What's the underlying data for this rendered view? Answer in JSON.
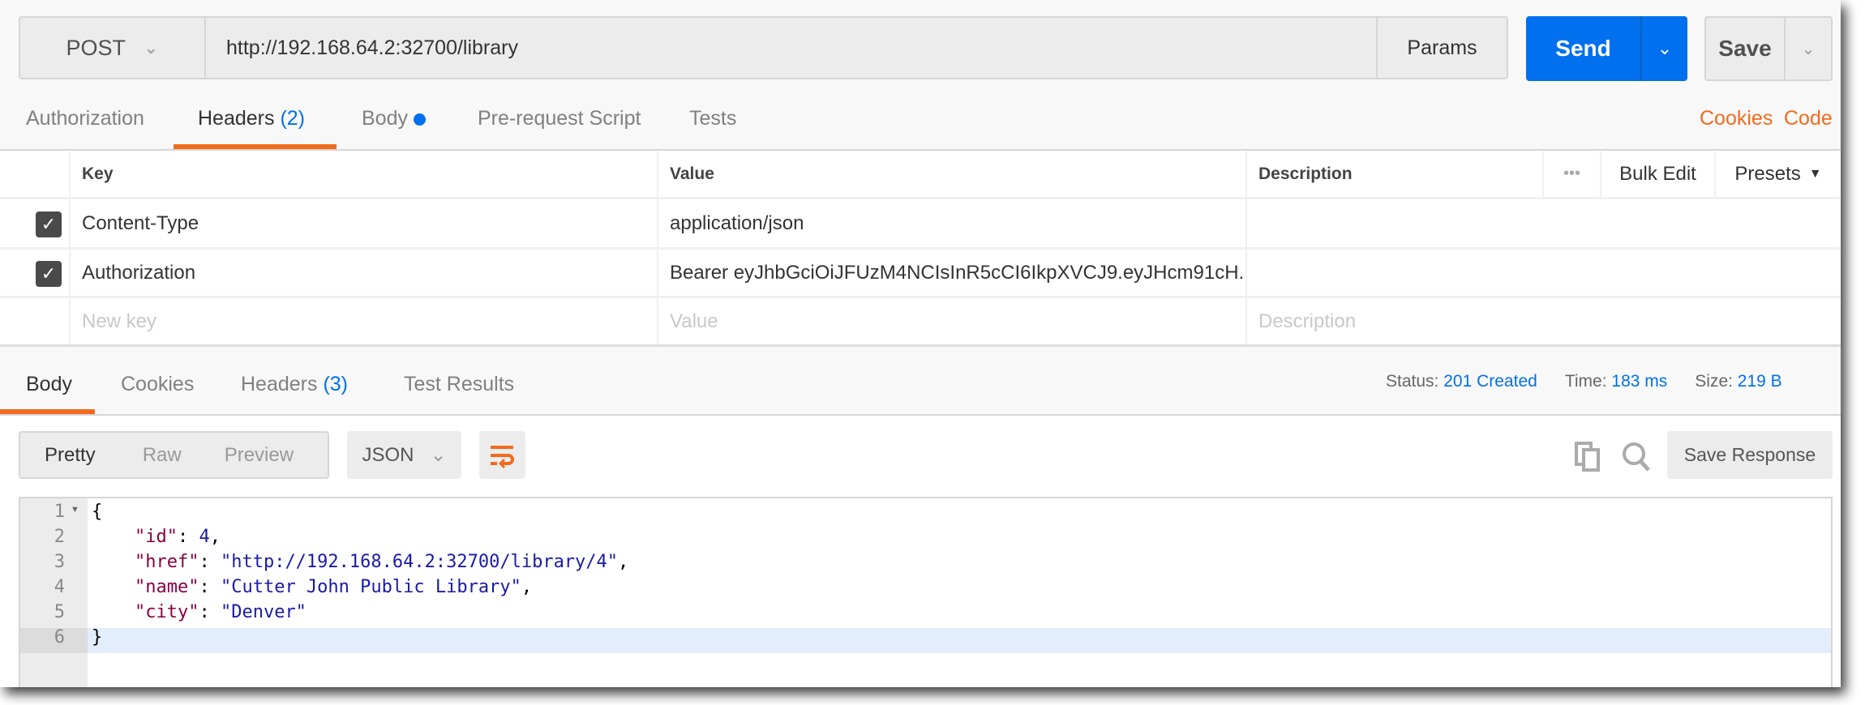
{
  "request": {
    "method": "POST",
    "url": "http://192.168.64.2:32700/library",
    "params_label": "Params",
    "send_label": "Send",
    "save_label": "Save"
  },
  "request_tabs": [
    {
      "label": "Authorization"
    },
    {
      "label": "Headers",
      "count": "(2)",
      "active": true
    },
    {
      "label": "Body",
      "dot": true
    },
    {
      "label": "Pre-request Script"
    },
    {
      "label": "Tests"
    }
  ],
  "request_links": {
    "cookies": "Cookies",
    "code": "Code"
  },
  "headers_table": {
    "columns": {
      "key": "Key",
      "value": "Value",
      "description": "Description"
    },
    "actions": {
      "more": "•••",
      "bulk_edit": "Bulk Edit",
      "presets": "Presets"
    },
    "rows": [
      {
        "checked": true,
        "key": "Content-Type",
        "value": "application/json",
        "description": ""
      },
      {
        "checked": true,
        "key": "Authorization",
        "value": "Bearer eyJhbGciOiJFUzM4NCIsInR5cCI6IkpXVCJ9.eyJHcm91cH...",
        "description": ""
      }
    ],
    "placeholders": {
      "key": "New key",
      "value": "Value",
      "description": "Description"
    }
  },
  "response_tabs": [
    {
      "label": "Body",
      "active": true
    },
    {
      "label": "Cookies"
    },
    {
      "label": "Headers",
      "count": "(3)"
    },
    {
      "label": "Test Results"
    }
  ],
  "response_meta": {
    "status_label": "Status:",
    "status": "201 Created",
    "time_label": "Time:",
    "time": "183 ms",
    "size_label": "Size:",
    "size": "219 B"
  },
  "response_toolbar": {
    "views": [
      "Pretty",
      "Raw",
      "Preview"
    ],
    "active_view": "Pretty",
    "format": "JSON",
    "save_response": "Save Response"
  },
  "response_body": {
    "line_numbers": [
      "1",
      "2",
      "3",
      "4",
      "5",
      "6"
    ],
    "lines": [
      [
        "{"
      ],
      [
        "    ",
        {
          "k": "\"id\""
        },
        ": ",
        {
          "n": "4"
        },
        ","
      ],
      [
        "    ",
        {
          "k": "\"href\""
        },
        ": ",
        {
          "s": "\"http://192.168.64.2:32700/library/4\""
        },
        ","
      ],
      [
        "    ",
        {
          "k": "\"name\""
        },
        ": ",
        {
          "s": "\"Cutter John Public Library\""
        },
        ","
      ],
      [
        "    ",
        {
          "k": "\"city\""
        },
        ": ",
        {
          "s": "\"Denver\""
        }
      ],
      [
        "}"
      ]
    ]
  },
  "colors": {
    "accent": "#f26b1d",
    "primary": "#0070ee",
    "json_key": "#880042",
    "json_string": "#1a1aa6"
  }
}
